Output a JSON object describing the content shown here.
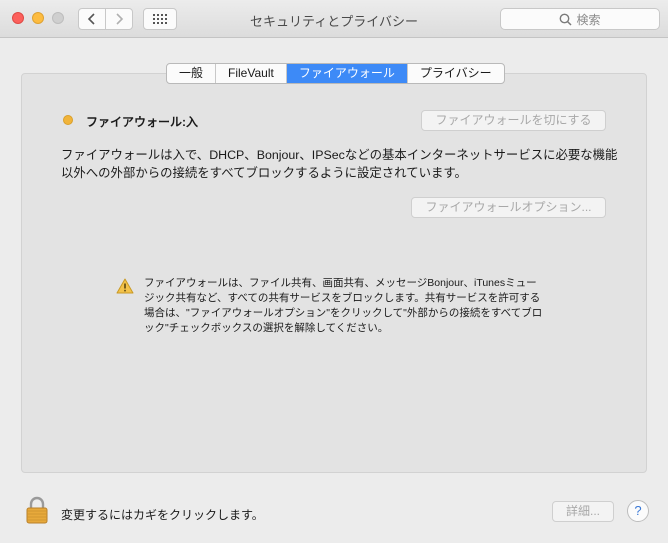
{
  "window": {
    "title": "セキュリティとプライバシー",
    "search_placeholder": "検索"
  },
  "tabs": [
    {
      "label": "一般",
      "active": false
    },
    {
      "label": "FileVault",
      "active": false
    },
    {
      "label": "ファイアウォール",
      "active": true
    },
    {
      "label": "プライバシー",
      "active": false
    }
  ],
  "firewall": {
    "status_label": "ファイアウォール:入",
    "status_color": "#f1b43a",
    "turn_off_button": "ファイアウォールを切にする",
    "description": "ファイアウォールは入で、DHCP、Bonjour、IPSecなどの基本インターネットサービスに必要な機能以外への外部からの接続をすべてブロックするように設定されています。",
    "options_button": "ファイアウォールオプション...",
    "warning_text": "ファイアウォールは、ファイル共有、画面共有、メッセージBonjour、iTunesミュージック共有など、すべての共有サービスをブロックします。共有サービスを許可する場合は、\"ファイアウォールオプション\"をクリックして\"外部からの接続をすべてブロック\"チェックボックスの選択を解除してください。"
  },
  "footer": {
    "lock_label": "変更するにはカギをクリックします。",
    "advanced_button": "詳細...",
    "help_label": "?"
  },
  "icons": {
    "back": "chevron-left-icon",
    "forward": "chevron-right-icon",
    "grid": "grid-icon",
    "search": "search-icon",
    "warning": "warning-icon",
    "lock": "lock-icon"
  }
}
